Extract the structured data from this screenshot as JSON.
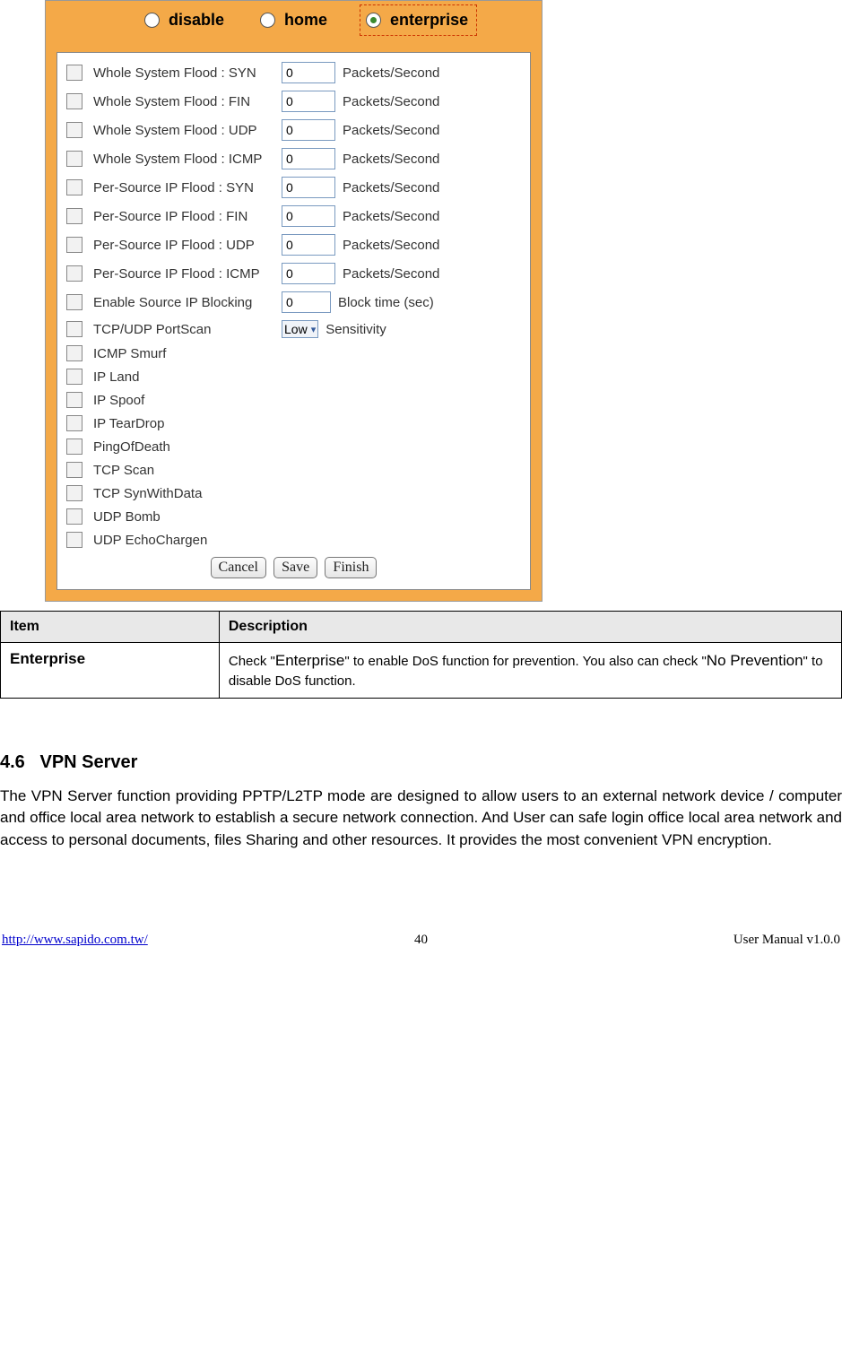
{
  "radios": {
    "disable": "disable",
    "home": "home",
    "enterprise": "enterprise"
  },
  "options": [
    {
      "label": "Whole System Flood : SYN",
      "value": "0",
      "unit": "Packets/Second",
      "has_input": true
    },
    {
      "label": "Whole System Flood : FIN",
      "value": "0",
      "unit": "Packets/Second",
      "has_input": true
    },
    {
      "label": "Whole System Flood : UDP",
      "value": "0",
      "unit": "Packets/Second",
      "has_input": true
    },
    {
      "label": "Whole System Flood : ICMP",
      "value": "0",
      "unit": "Packets/Second",
      "has_input": true
    },
    {
      "label": "Per-Source IP Flood : SYN",
      "value": "0",
      "unit": "Packets/Second",
      "has_input": true
    },
    {
      "label": "Per-Source IP Flood : FIN",
      "value": "0",
      "unit": "Packets/Second",
      "has_input": true
    },
    {
      "label": "Per-Source IP Flood : UDP",
      "value": "0",
      "unit": "Packets/Second",
      "has_input": true
    },
    {
      "label": "Per-Source IP Flood : ICMP",
      "value": "0",
      "unit": "Packets/Second",
      "has_input": true
    },
    {
      "label": "Enable Source IP Blocking",
      "value": "0",
      "unit": "Block time (sec)",
      "has_input": true,
      "small": true
    },
    {
      "label": "TCP/UDP PortScan",
      "select": "Low",
      "unit": "Sensitivity",
      "has_select": true
    },
    {
      "label": "ICMP Smurf"
    },
    {
      "label": "IP Land"
    },
    {
      "label": "IP Spoof"
    },
    {
      "label": "IP TearDrop"
    },
    {
      "label": "PingOfDeath"
    },
    {
      "label": "TCP Scan"
    },
    {
      "label": "TCP SynWithData"
    },
    {
      "label": "UDP Bomb"
    },
    {
      "label": "UDP EchoChargen"
    }
  ],
  "buttons": {
    "cancel": "Cancel",
    "save": "Save",
    "finish": "Finish"
  },
  "table": {
    "h1": "Item",
    "h2": "Description",
    "item": "Enterprise",
    "desc_pre": "Check \"",
    "desc_kw1": "Enterprise",
    "desc_mid": "\" to enable DoS function for prevention. You also can check \"",
    "desc_kw2": "No Prevention",
    "desc_post": "\" to disable DoS function."
  },
  "section": {
    "num": "4.6",
    "title": "VPN Server"
  },
  "paragraph": "The VPN Server function providing PPTP/L2TP mode are designed to allow users to an external network device / computer and office local area network to establish a secure network connection. And User can safe login office local area network and access to personal documents, files Sharing and other resources. It provides the most convenient VPN encryption.",
  "footer": {
    "url": "http://www.sapido.com.tw/",
    "page": "40",
    "right": "User Manual v1.0.0"
  }
}
